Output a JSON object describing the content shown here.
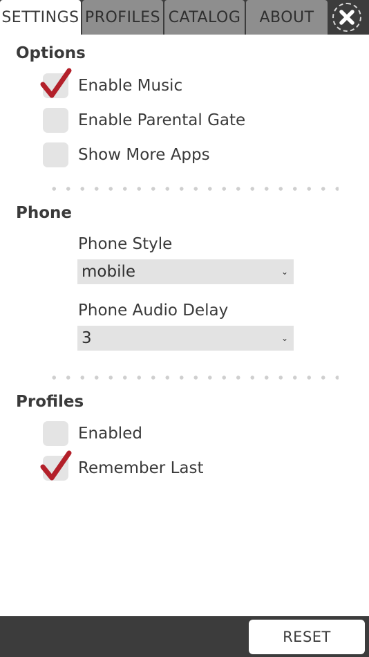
{
  "tabs": [
    {
      "label": "SETTINGS",
      "active": true
    },
    {
      "label": "PROFILES",
      "active": false
    },
    {
      "label": "CATALOG",
      "active": false
    },
    {
      "label": "ABOUT",
      "active": false
    }
  ],
  "close_icon": "close-x-icon",
  "options": {
    "title": "Options",
    "items": [
      {
        "label": "Enable Music",
        "checked": true
      },
      {
        "label": "Enable Parental Gate",
        "checked": false
      },
      {
        "label": "Show More Apps",
        "checked": false
      }
    ]
  },
  "phone": {
    "title": "Phone",
    "style": {
      "label": "Phone Style",
      "value": "mobile"
    },
    "delay": {
      "label": "Phone Audio Delay",
      "value": "3"
    }
  },
  "profiles": {
    "title": "Profiles",
    "items": [
      {
        "label": "Enabled",
        "checked": false
      },
      {
        "label": "Remember Last",
        "checked": true
      }
    ]
  },
  "footer": {
    "reset_label": "RESET"
  },
  "colors": {
    "bar": "#3c3c3c",
    "tab_inactive": "#8e8e8e",
    "checkbox": "#e4e4e4",
    "checkmark": "#b3202a"
  }
}
